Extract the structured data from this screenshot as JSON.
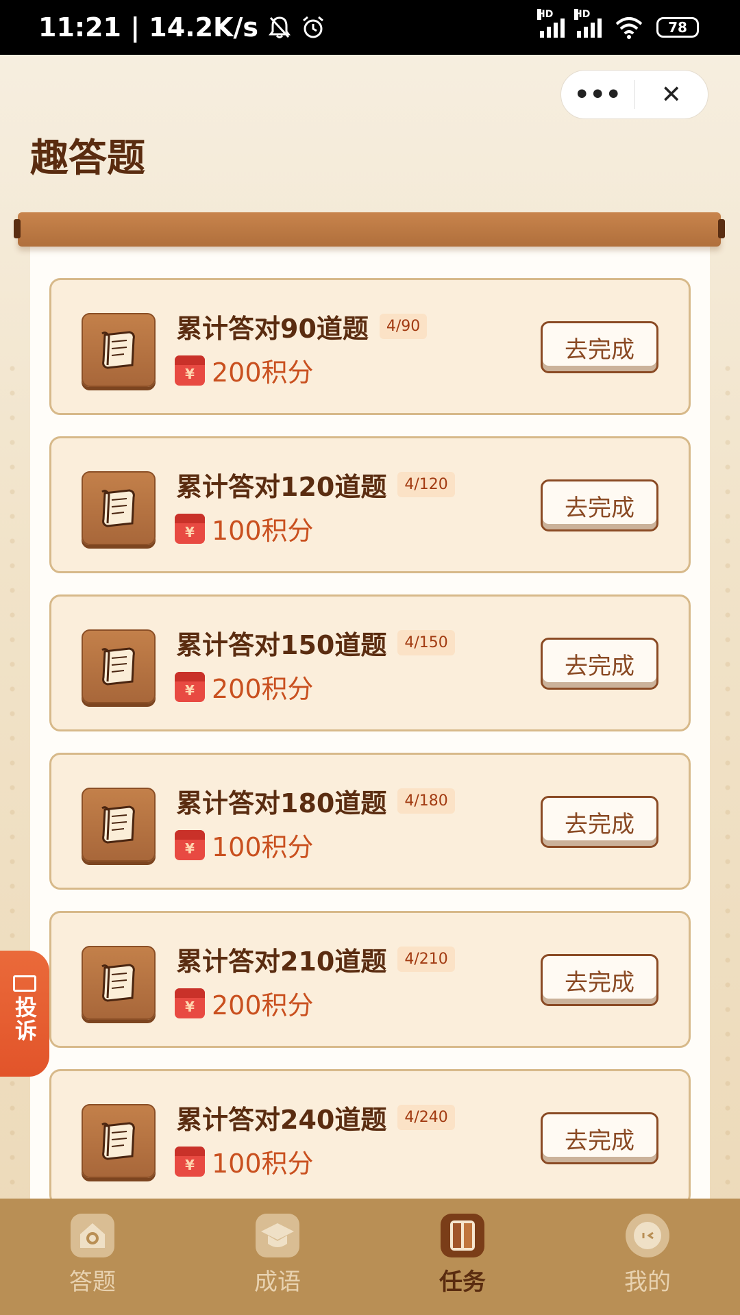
{
  "status_bar": {
    "time": "11:21 | 14.2K/s",
    "hd_label": "HD",
    "battery": "78"
  },
  "capsule": {
    "more_label": "•••",
    "close_label": "✕"
  },
  "page_title": "趣答题",
  "tasks": [
    {
      "title": "累计答对90道题",
      "progress": "4/90",
      "reward": "200积分",
      "button": "去完成"
    },
    {
      "title": "累计答对120道题",
      "progress": "4/120",
      "reward": "100积分",
      "button": "去完成"
    },
    {
      "title": "累计答对150道题",
      "progress": "4/150",
      "reward": "200积分",
      "button": "去完成"
    },
    {
      "title": "累计答对180道题",
      "progress": "4/180",
      "reward": "100积分",
      "button": "去完成"
    },
    {
      "title": "累计答对210道题",
      "progress": "4/210",
      "reward": "200积分",
      "button": "去完成"
    },
    {
      "title": "累计答对240道题",
      "progress": "4/240",
      "reward": "100积分",
      "button": "去完成"
    }
  ],
  "complaint": {
    "label": "投诉"
  },
  "tabbar": {
    "items": [
      {
        "label": "答题",
        "icon": "house-icon"
      },
      {
        "label": "成语",
        "icon": "graduation-cap-icon"
      },
      {
        "label": "任务",
        "icon": "book-icon",
        "active": true
      },
      {
        "label": "我的",
        "icon": "face-icon"
      }
    ]
  },
  "colors": {
    "accent": "#5a2c10",
    "reward": "#c9501f",
    "tabbar": "#b98f55",
    "complaint": "#e2542a"
  }
}
